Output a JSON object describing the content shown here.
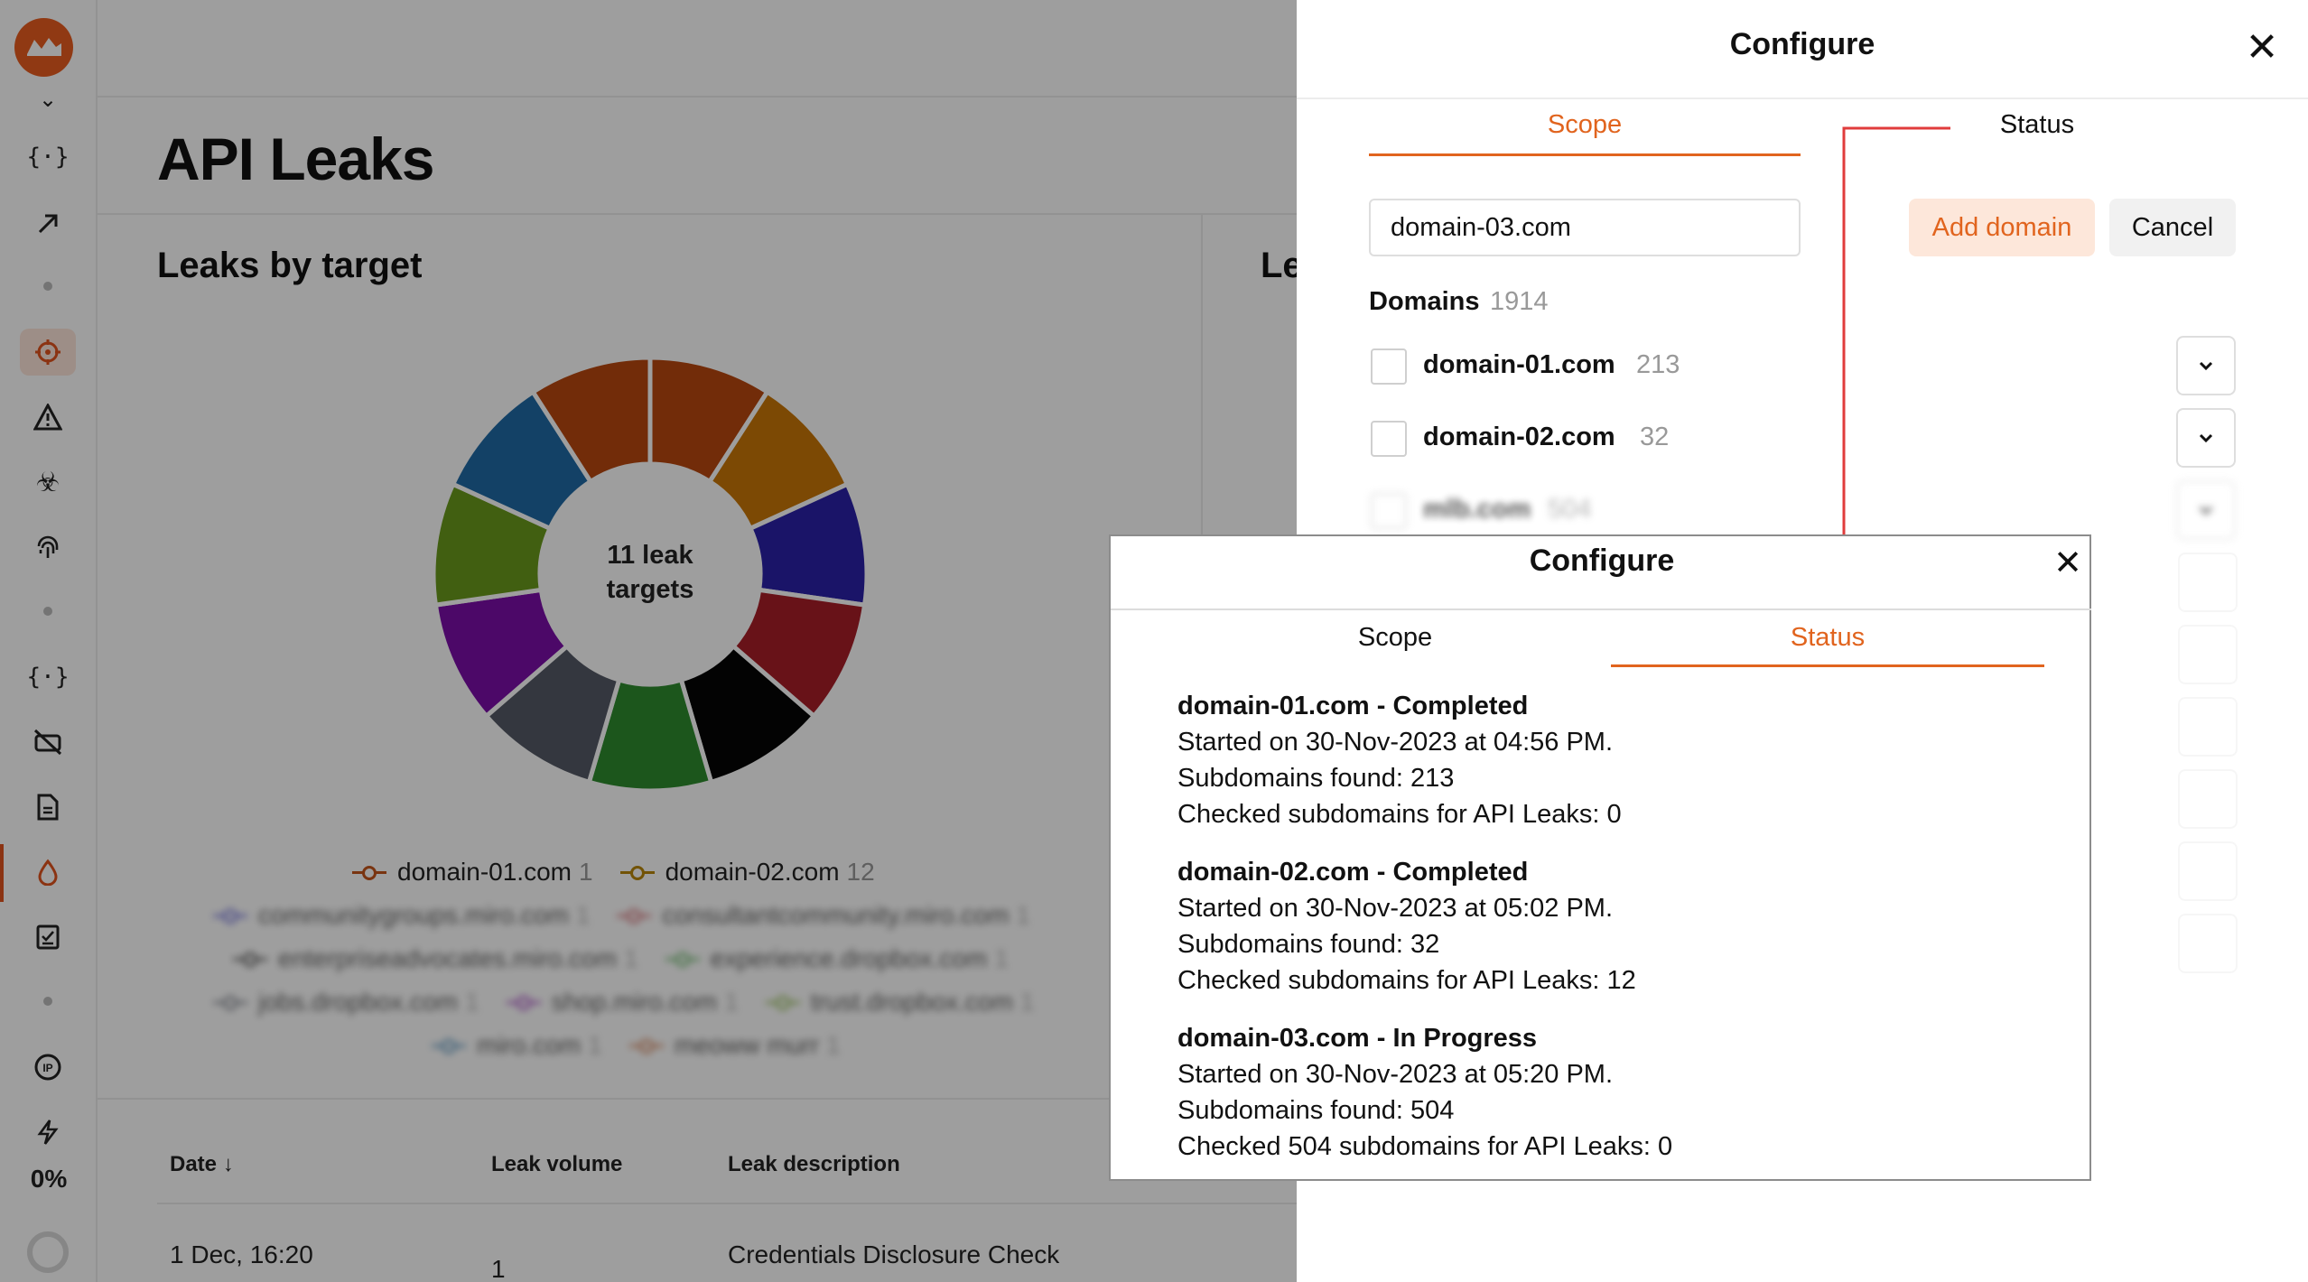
{
  "app": {
    "page_title": "API Leaks",
    "card_title": "Leaks by target",
    "card2_title_partial": "Le",
    "donut_center_line1": "11 leak",
    "donut_center_line2": "targets",
    "progress_percent": "0%",
    "legend": [
      {
        "label": "domain-01.com",
        "count": "1",
        "color": "#c4541a"
      },
      {
        "label": "domain-02.com",
        "count": "12",
        "color": "#b8860b"
      },
      {
        "label": "communitygroups.miro.com",
        "count": "1",
        "color": "#3a3acc"
      },
      {
        "label": "consultantcommunity.miro.com",
        "count": "1",
        "color": "#c0303a"
      },
      {
        "label": "enterpriseadvocates.miro.com",
        "count": "1",
        "color": "#111111"
      },
      {
        "label": "experience.dropbox.com",
        "count": "1",
        "color": "#2e9a2e"
      },
      {
        "label": "jobs.dropbox.com",
        "count": "1",
        "color": "#555a66"
      },
      {
        "label": "shop.miro.com",
        "count": "1",
        "color": "#8a10b0"
      },
      {
        "label": "trust.dropbox.com",
        "count": "1",
        "color": "#6ea51c"
      },
      {
        "label": "miro.com",
        "count": "1",
        "color": "#1f6fa8"
      },
      {
        "label": "meoww murr",
        "count": "1",
        "color": "#c4541a"
      }
    ],
    "table": {
      "headers": [
        "Date",
        "Leak volume",
        "Leak description"
      ],
      "rows": [
        {
          "date": "1 Dec, 16:20",
          "volume": "1",
          "description": "Credentials Disclosure Check"
        }
      ]
    }
  },
  "chart_data": {
    "type": "pie",
    "title": "Leaks by target",
    "categories": [
      "domain-01.com",
      "domain-02.com",
      "communitygroups.miro.com",
      "consultantcommunity.miro.com",
      "enterpriseadvocates.miro.com",
      "experience.dropbox.com",
      "jobs.dropbox.com",
      "shop.miro.com",
      "trust.dropbox.com",
      "miro.com",
      "meoww murr"
    ],
    "values": [
      1,
      12,
      1,
      1,
      1,
      1,
      1,
      1,
      1,
      1,
      1
    ],
    "colors": [
      "#b8470f",
      "#b8860b",
      "#2a21a8",
      "#a81e28",
      "#000000",
      "#2e8b2e",
      "#555a66",
      "#7b0ea8",
      "#6a9a1c",
      "#1f6aa5",
      "#b8470f"
    ],
    "legend_position": "bottom"
  },
  "panel": {
    "title": "Configure",
    "tabs": [
      {
        "label": "Scope"
      },
      {
        "label": "Status"
      }
    ],
    "input_value": "domain-03.com",
    "add_domain_label": "Add domain",
    "cancel_label": "Cancel",
    "domains_heading": "Domains",
    "domains_count": "1914",
    "domains": [
      {
        "name": "domain-01.com",
        "count": "213"
      },
      {
        "name": "domain-02.com",
        "count": "32"
      },
      {
        "name": "mlb.com",
        "count": "504"
      }
    ]
  },
  "popup": {
    "title": "Configure",
    "tabs": [
      {
        "label": "Scope"
      },
      {
        "label": "Status"
      }
    ],
    "statuses": [
      {
        "title": "domain-01.com - Completed",
        "started": "Started on 30-Nov-2023 at 04:56 PM.",
        "found": "Subdomains found: 213",
        "checked": "Checked subdomains for API Leaks: 0"
      },
      {
        "title": "domain-02.com - Completed",
        "started": "Started on 30-Nov-2023 at 05:02 PM.",
        "found": "Subdomains found: 32",
        "checked": "Checked subdomains for API Leaks: 12"
      },
      {
        "title": "domain-03.com - In Progress",
        "started": "Started on 30-Nov-2023 at 05:20 PM.",
        "found": "Subdomains found: 504",
        "checked": "Checked 504 subdomains for API Leaks: 0"
      }
    ]
  },
  "colors": {
    "accent": "#e1641e",
    "arrow": "#e03c3c"
  }
}
